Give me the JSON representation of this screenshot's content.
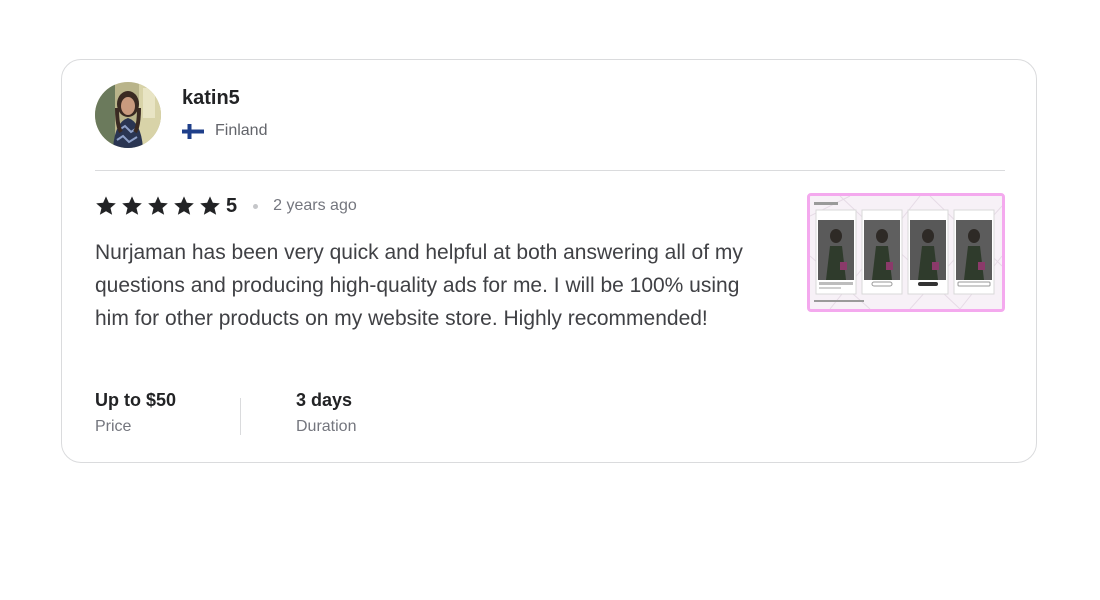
{
  "reviewer": {
    "username": "katin5",
    "country": "Finland",
    "avatar_icon": "avatar-photo",
    "flag_icon": "finland-flag-icon"
  },
  "rating": {
    "stars": 5,
    "value": "5",
    "time_ago": "2 years ago",
    "star_color": "#222325"
  },
  "review_text": "Nurjaman has been very quick and helpful at both answering all of my questions and producing high-quality ads for me. I will be 100% using him for other products on my website store. Highly recommended!",
  "meta": {
    "price_value": "Up to $50",
    "price_label": "Price",
    "duration_value": "3 days",
    "duration_label": "Duration"
  },
  "attachment": {
    "type": "image-thumbnail",
    "border_color": "#f4a9ee"
  }
}
